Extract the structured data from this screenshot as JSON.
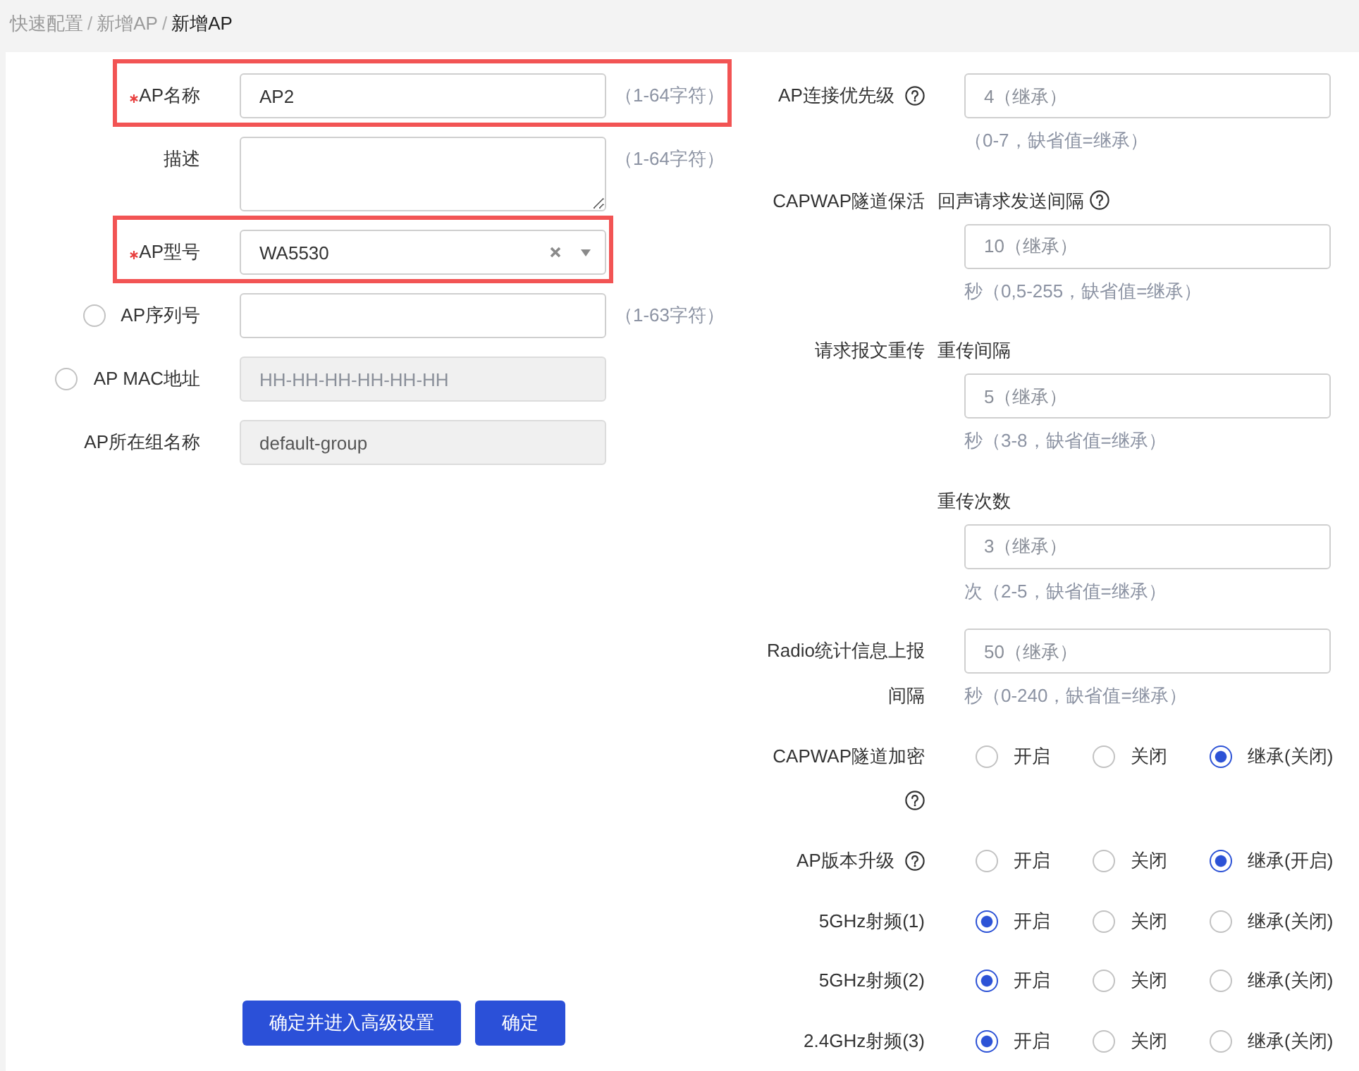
{
  "breadcrumb": [
    {
      "kind": "link",
      "text": "快速配置"
    },
    {
      "kind": "separator",
      "text": "/"
    },
    {
      "kind": "link",
      "text": "新增AP"
    },
    {
      "kind": "separator",
      "text": "/"
    },
    {
      "kind": "current",
      "text": "新增AP"
    }
  ],
  "basic_fields": [
    {
      "kind": "text",
      "label": "AP名称",
      "required": true,
      "highlighted": true,
      "disabled": false,
      "value": "AP2",
      "hint": "（1-64字符）"
    },
    {
      "kind": "textarea",
      "label": "描述",
      "required": false,
      "highlighted": false,
      "disabled": false,
      "hint": "（1-64字符）"
    },
    {
      "kind": "select",
      "label": "AP型号",
      "required": true,
      "highlighted": true,
      "disabled": false,
      "value": "WA5530"
    },
    {
      "kind": "radio-text",
      "label": "AP序列号",
      "required": false,
      "highlighted": false,
      "disabled": false,
      "selected": false,
      "hint": "（1-63字符）"
    },
    {
      "kind": "radio-text",
      "label": "AP MAC地址",
      "required": false,
      "highlighted": false,
      "disabled": true,
      "selected": false,
      "placeholder": "HH-HH-HH-HH-HH-HH"
    },
    {
      "kind": "text",
      "label": "AP所在组名称",
      "required": false,
      "highlighted": false,
      "disabled": true,
      "value": "default-group"
    }
  ],
  "advanced_fields": [
    {
      "kind": "input",
      "label": "AP连接优先级",
      "help": true,
      "placeholder": "4（继承）",
      "hint": "（0-7，缺省值=继承）"
    },
    {
      "kind": "input",
      "label": "CAPWAP隧道保活",
      "sublabel": "回声请求发送间隔",
      "help": true,
      "placeholder": "10（继承）",
      "hint": "秒（0,5-255，缺省值=继承）"
    },
    {
      "kind": "input",
      "label": "请求报文重传",
      "sublabel": "重传间隔",
      "help": false,
      "placeholder": "5（继承）",
      "hint": "秒（3-8，缺省值=继承）"
    },
    {
      "kind": "input",
      "sublabel": "重传次数",
      "help": false,
      "placeholder": "3（继承）",
      "hint": "次（2-5，缺省值=继承）"
    },
    {
      "kind": "input",
      "label": "Radio统计信息上报间隔",
      "help": false,
      "placeholder": "50（继承）",
      "hint": "秒（0-240，缺省值=继承）"
    },
    {
      "kind": "radio",
      "label": "CAPWAP隧道加密",
      "help": true,
      "options": [
        {
          "label": "开启",
          "selected": false
        },
        {
          "label": "关闭",
          "selected": false
        },
        {
          "label": "继承(关闭)",
          "selected": true
        }
      ]
    },
    {
      "kind": "radio",
      "label": "AP版本升级",
      "help": true,
      "options": [
        {
          "label": "开启",
          "selected": false
        },
        {
          "label": "关闭",
          "selected": false
        },
        {
          "label": "继承(开启)",
          "selected": true
        }
      ]
    },
    {
      "kind": "radio",
      "label": "5GHz射频(1)",
      "help": false,
      "options": [
        {
          "label": "开启",
          "selected": true
        },
        {
          "label": "关闭",
          "selected": false
        },
        {
          "label": "继承(关闭)",
          "selected": false
        }
      ]
    },
    {
      "kind": "radio",
      "label": "5GHz射频(2)",
      "help": false,
      "options": [
        {
          "label": "开启",
          "selected": true
        },
        {
          "label": "关闭",
          "selected": false
        },
        {
          "label": "继承(关闭)",
          "selected": false
        }
      ]
    },
    {
      "kind": "radio",
      "label": "2.4GHz射频(3)",
      "help": false,
      "options": [
        {
          "label": "开启",
          "selected": true
        },
        {
          "label": "关闭",
          "selected": false
        },
        {
          "label": "继承(关闭)",
          "selected": false
        }
      ]
    }
  ],
  "buttons": [
    {
      "kind": "primary",
      "label": "确定并进入高级设置"
    },
    {
      "kind": "primary",
      "label": "确定"
    }
  ]
}
